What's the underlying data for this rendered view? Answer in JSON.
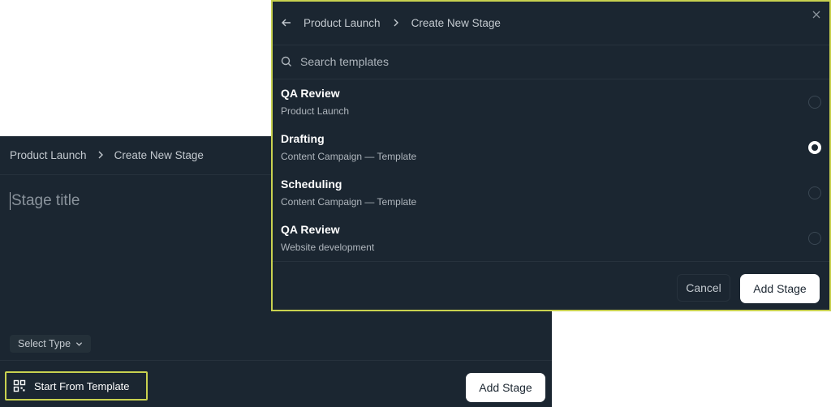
{
  "back_panel": {
    "breadcrumb": [
      "Product Launch",
      "Create New Stage"
    ],
    "title_placeholder": "Stage title",
    "select_type_label": "Select Type",
    "start_template_label": "Start From Template",
    "add_stage_label": "Add Stage"
  },
  "modal": {
    "breadcrumb": [
      "Product Launch",
      "Create New Stage"
    ],
    "search_placeholder": "Search templates",
    "templates": [
      {
        "name": "QA Review",
        "subtitle": "Product Launch",
        "selected": false
      },
      {
        "name": "Drafting",
        "subtitle": "Content Campaign — Template",
        "selected": true
      },
      {
        "name": "Scheduling",
        "subtitle": "Content Campaign — Template",
        "selected": false
      },
      {
        "name": "QA Review",
        "subtitle": "Website development",
        "selected": false
      }
    ],
    "cancel_label": "Cancel",
    "add_stage_label": "Add Stage"
  },
  "colors": {
    "panel_bg": "#1b2631",
    "highlight": "#c8d14f",
    "primary_button": "#ffffff"
  },
  "icons": [
    "chevron-right-icon",
    "chevron-down-icon",
    "template-grid-icon",
    "arrow-left-icon",
    "close-icon",
    "search-icon"
  ]
}
